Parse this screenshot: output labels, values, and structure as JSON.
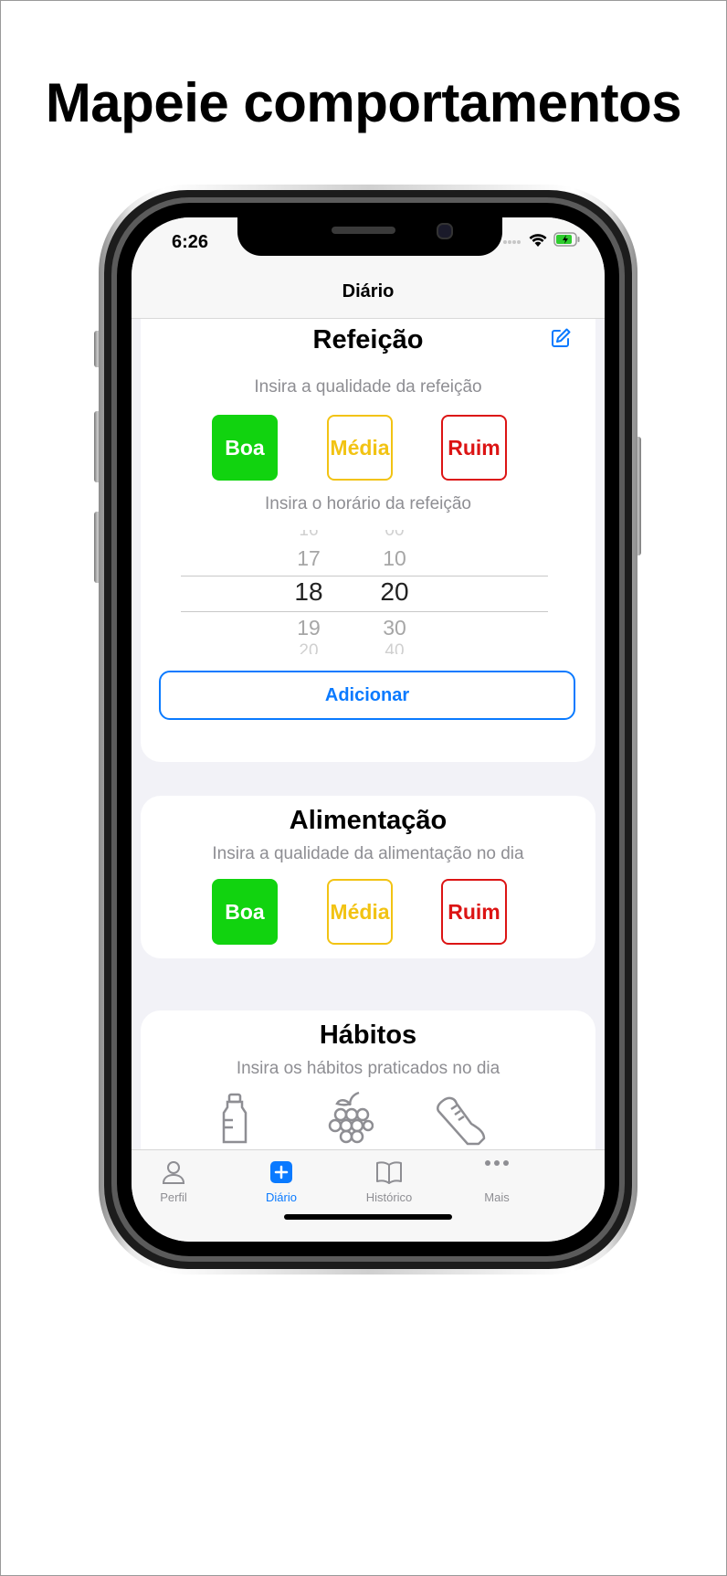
{
  "headline": "Mapeie comportamentos",
  "status_bar": {
    "time": "6:26"
  },
  "nav": {
    "title": "Diário"
  },
  "meal_card": {
    "title": "Refeição",
    "quality_prompt": "Insira a qualidade da refeição",
    "time_prompt": "Insira o horário da refeição",
    "quality_options": [
      "Boa",
      "Média",
      "Ruim"
    ],
    "hour_picker": {
      "above": "17",
      "selected": "18",
      "below": "19"
    },
    "minute_picker": {
      "above": "10",
      "selected": "20",
      "below": "30"
    },
    "add_button": "Adicionar"
  },
  "food_card": {
    "title": "Alimentação",
    "prompt": "Insira a qualidade da alimentação no dia",
    "quality_options": [
      "Boa",
      "Média",
      "Ruim"
    ]
  },
  "habits_card": {
    "title": "Hábitos",
    "prompt": "Insira os hábitos praticados no dia",
    "icons": [
      "water-bottle-icon",
      "grapes-icon",
      "sneaker-icon"
    ]
  },
  "tab_bar": {
    "items": [
      {
        "label": "Perfil",
        "icon": "person-icon",
        "active": false
      },
      {
        "label": "Diário",
        "icon": "plus-square-icon",
        "active": true
      },
      {
        "label": "Histórico",
        "icon": "book-icon",
        "active": false
      },
      {
        "label": "Mais",
        "icon": "more-icon",
        "active": false
      }
    ]
  },
  "colors": {
    "accent": "#0a7aff",
    "good": "#11d30f",
    "medium": "#f2c313",
    "bad": "#dc1414"
  }
}
